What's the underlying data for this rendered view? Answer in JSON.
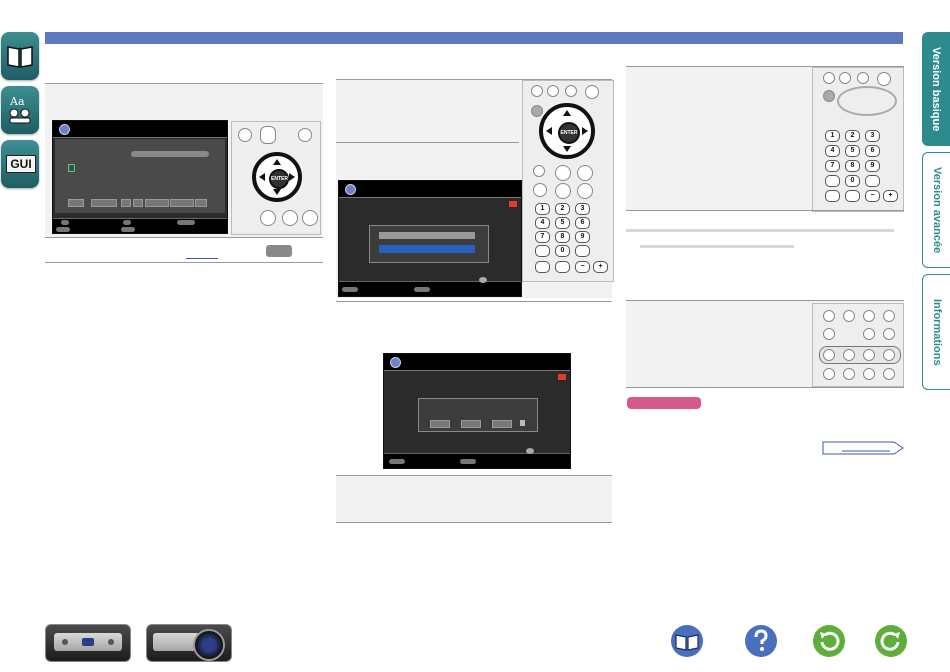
{
  "tabs": {
    "basic": "Version basique",
    "advanced": "Version avancée",
    "info": "Informations"
  },
  "left_icons": {
    "gui_label": "GUI"
  },
  "remote": {
    "enter_label": "ENTER"
  },
  "colors": {
    "header": "#5e79bd",
    "tab_active": "#2d8b8e",
    "left_icon": "#2a7479",
    "badge_pink": "#d35a8a",
    "nav_blue": "#4a6fbf",
    "nav_green": "#5fae3c"
  },
  "icons": [
    "book-icon",
    "glossary-icon",
    "gui-icon",
    "table-of-contents-icon",
    "help-icon",
    "back-icon",
    "forward-icon"
  ]
}
